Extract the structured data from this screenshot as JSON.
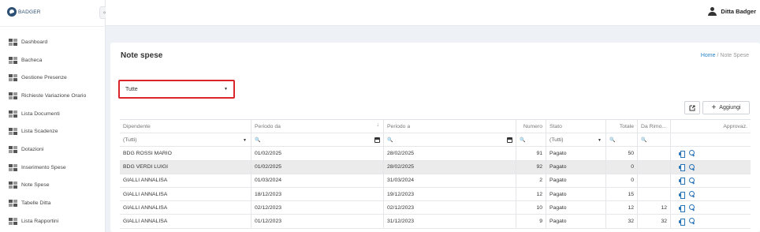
{
  "app": {
    "logo_text": "BADGER",
    "collapse_icon": "«"
  },
  "user": {
    "name": "Ditta Badger"
  },
  "sidebar": {
    "items": [
      {
        "label": "Dashboard"
      },
      {
        "label": "Bacheca"
      },
      {
        "label": "Gestione Presenze"
      },
      {
        "label": "Richieste Variazione Orario"
      },
      {
        "label": "Lista Documenti"
      },
      {
        "label": "Lista Scadenze"
      },
      {
        "label": "Dotazioni"
      },
      {
        "label": "Inserimento Spese"
      },
      {
        "label": "Note Spese"
      },
      {
        "label": "Tabelle Ditta"
      },
      {
        "label": "Lista Rapportini"
      }
    ]
  },
  "page": {
    "title": "Note spese",
    "breadcrumb": {
      "home": "Home",
      "separator": "/",
      "current": "Note Spese"
    },
    "filter_select": {
      "value": "Tutte",
      "caret": "▼"
    },
    "export_icon": "export-icon",
    "add_button": {
      "plus": "+",
      "label": "Aggiungi"
    }
  },
  "grid": {
    "headers": {
      "dipendente": "Dipendente",
      "periodo_da": "Periodo da",
      "periodo_a": "Periodo a",
      "numero": "Numero",
      "stato": "Stato",
      "totale": "Totale",
      "da_rimb": "Da Rimo...",
      "approvaz": "Approvaz.",
      "sort_icon": "↓"
    },
    "filters": {
      "dipendente": "(Tutti)",
      "search_icon": "🔍",
      "stato": "(Tutti)",
      "caret": "▼"
    },
    "rows": [
      {
        "dipendente": "BDG ROSSI MARIO",
        "da": "01/02/2025",
        "a": "28/02/2025",
        "numero": "91",
        "stato": "Pagato",
        "totale": "50",
        "rimb": ""
      },
      {
        "dipendente": "BDG VERDI LUIGI",
        "da": "01/02/2025",
        "a": "28/02/2025",
        "numero": "92",
        "stato": "Pagato",
        "totale": "0",
        "rimb": ""
      },
      {
        "dipendente": "GIALLI ANNALISA",
        "da": "01/03/2024",
        "a": "31/03/2024",
        "numero": "2",
        "stato": "Pagato",
        "totale": "0",
        "rimb": ""
      },
      {
        "dipendente": "GIALLI ANNALISA",
        "da": "18/12/2023",
        "a": "19/12/2023",
        "numero": "12",
        "stato": "Pagato",
        "totale": "15",
        "rimb": ""
      },
      {
        "dipendente": "GIALLI ANNALISA",
        "da": "02/12/2023",
        "a": "02/12/2023",
        "numero": "10",
        "stato": "Pagato",
        "totale": "12",
        "rimb": "12"
      },
      {
        "dipendente": "GIALLI ANNALISA",
        "da": "01/12/2023",
        "a": "31/12/2023",
        "numero": "9",
        "stato": "Pagato",
        "totale": "32",
        "rimb": "32"
      }
    ]
  },
  "colors": {
    "accent": "#2a74b8",
    "highlight_border": "#d9262c",
    "selected_row": "#ebebeb"
  }
}
